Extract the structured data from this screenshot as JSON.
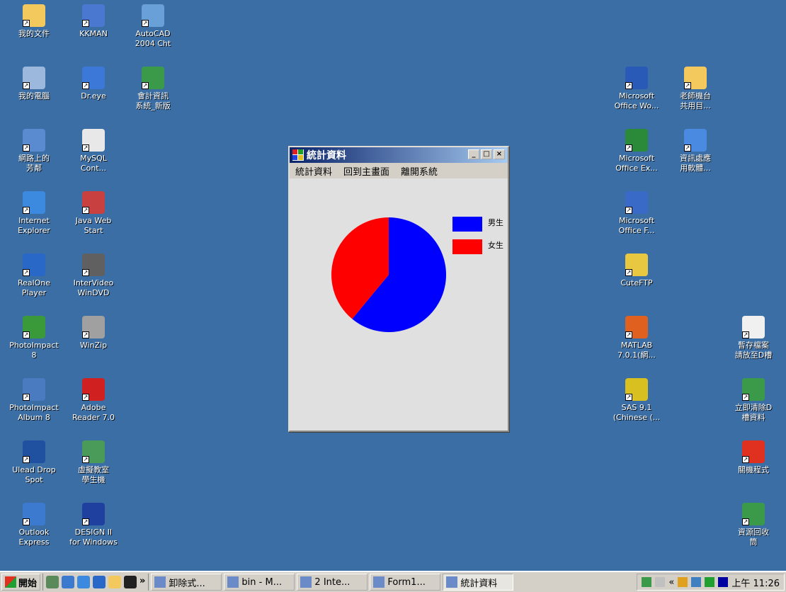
{
  "desktop": {
    "icons_left": [
      {
        "label": "我的文件",
        "icon": "my-documents-icon",
        "color": "#f3c85c"
      },
      {
        "label": "KKMAN",
        "icon": "kkman-icon",
        "color": "#4a78d0"
      },
      {
        "label": "AutoCAD\n2004 Cht",
        "icon": "autocad-icon",
        "color": "#6aa0d8"
      },
      {
        "label": "我的電腦",
        "icon": "my-computer-icon",
        "color": "#9cb8dc"
      },
      {
        "label": "Dr.eye",
        "icon": "dreye-icon",
        "color": "#3b78d8"
      },
      {
        "label": "會計資訊\n系統_新版",
        "icon": "excel-file-icon",
        "color": "#3a9a4a"
      },
      {
        "label": "網路上的\n芳鄰",
        "icon": "network-places-icon",
        "color": "#5a8ad0"
      },
      {
        "label": "MySQL\nCont...",
        "icon": "mysql-icon",
        "color": "#e8e8e8"
      },
      {
        "label": "Internet\nExplorer",
        "icon": "internet-explorer-icon",
        "color": "#3c8ae0"
      },
      {
        "label": "Java Web\nStart",
        "icon": "java-icon",
        "color": "#c84040"
      },
      {
        "label": "RealOne\nPlayer",
        "icon": "realone-icon",
        "color": "#2a68c8"
      },
      {
        "label": "InterVideo\nWinDVD",
        "icon": "windvd-icon",
        "color": "#606060"
      },
      {
        "label": "PhotoImpact\n8",
        "icon": "photoimpact-icon",
        "color": "#3a9a3a"
      },
      {
        "label": "WinZip",
        "icon": "winzip-icon",
        "color": "#a0a0a0"
      },
      {
        "label": "PhotoImpact\nAlbum 8",
        "icon": "photoimpact-album-icon",
        "color": "#4a7ac0"
      },
      {
        "label": "Adobe\nReader 7.0",
        "icon": "adobe-reader-icon",
        "color": "#d02020"
      },
      {
        "label": "Ulead Drop\nSpot",
        "icon": "ulead-icon",
        "color": "#2050a0"
      },
      {
        "label": "虛擬教室\n學生機",
        "icon": "virtual-classroom-icon",
        "color": "#4a9a5a"
      },
      {
        "label": "Outlook\nExpress",
        "icon": "outlook-express-icon",
        "color": "#3c7ad0"
      },
      {
        "label": "DESIGN II\nfor Windows",
        "icon": "design2-icon",
        "color": "#2040a0"
      }
    ],
    "icons_right": [
      {
        "label": "Microsoft\nOffice Wo...",
        "icon": "word-icon",
        "color": "#2a5ab8"
      },
      {
        "label": "老師機台\n共用目...",
        "icon": "shared-folder-icon",
        "color": "#f3c85c"
      },
      {
        "label": "Microsoft\nOffice Ex...",
        "icon": "excel-icon",
        "color": "#2a8a3a"
      },
      {
        "label": "資訊處應\n用軟體...",
        "icon": "software-icon",
        "color": "#4a8ae0"
      },
      {
        "label": "Microsoft\nOffice F...",
        "icon": "frontpage-icon",
        "color": "#3a6ac8"
      },
      {
        "label": "CuteFTP",
        "icon": "cuteftp-icon",
        "color": "#e8c840"
      },
      {
        "label": "MATLAB\n7.0.1(網...",
        "icon": "matlab-icon",
        "color": "#e06020"
      },
      {
        "label": "SAS 9.1\n(Chinese (...",
        "icon": "sas-icon",
        "color": "#d8c020"
      },
      {
        "label": "暫存檔案\n請放至D槽",
        "icon": "text-file-icon",
        "color": "#f0f0f0"
      },
      {
        "label": "立即清除D\n槽資料",
        "icon": "recycle-icon",
        "color": "#3a9a4a"
      },
      {
        "label": "關機程式",
        "icon": "shutdown-icon",
        "color": "#e03020"
      },
      {
        "label": "資源回收\n筒",
        "icon": "recycle-bin-icon",
        "color": "#3a9a4a"
      }
    ]
  },
  "window": {
    "title": "統計資料",
    "menu": [
      "統計資料",
      "回到主畫面",
      "離開系統"
    ],
    "buttons": {
      "minimize": "_",
      "maximize": "□",
      "close": "×"
    }
  },
  "chart_data": {
    "type": "pie",
    "series": [
      {
        "name": "男生",
        "value": 61,
        "color": "#0000ff"
      },
      {
        "name": "女生",
        "value": 39,
        "color": "#ff0000"
      }
    ],
    "legend_position": "right"
  },
  "taskbar": {
    "start_label": "開始",
    "chevron": "»",
    "tasks": [
      {
        "label": "卸除式...",
        "active": false
      },
      {
        "label": "bin - M...",
        "active": false
      },
      {
        "label": "2 Inte...",
        "active": false
      },
      {
        "label": "Form1...",
        "active": false
      },
      {
        "label": "統計資料",
        "active": true
      }
    ],
    "tray_chevron": "«",
    "clock": "上午 11:26"
  }
}
